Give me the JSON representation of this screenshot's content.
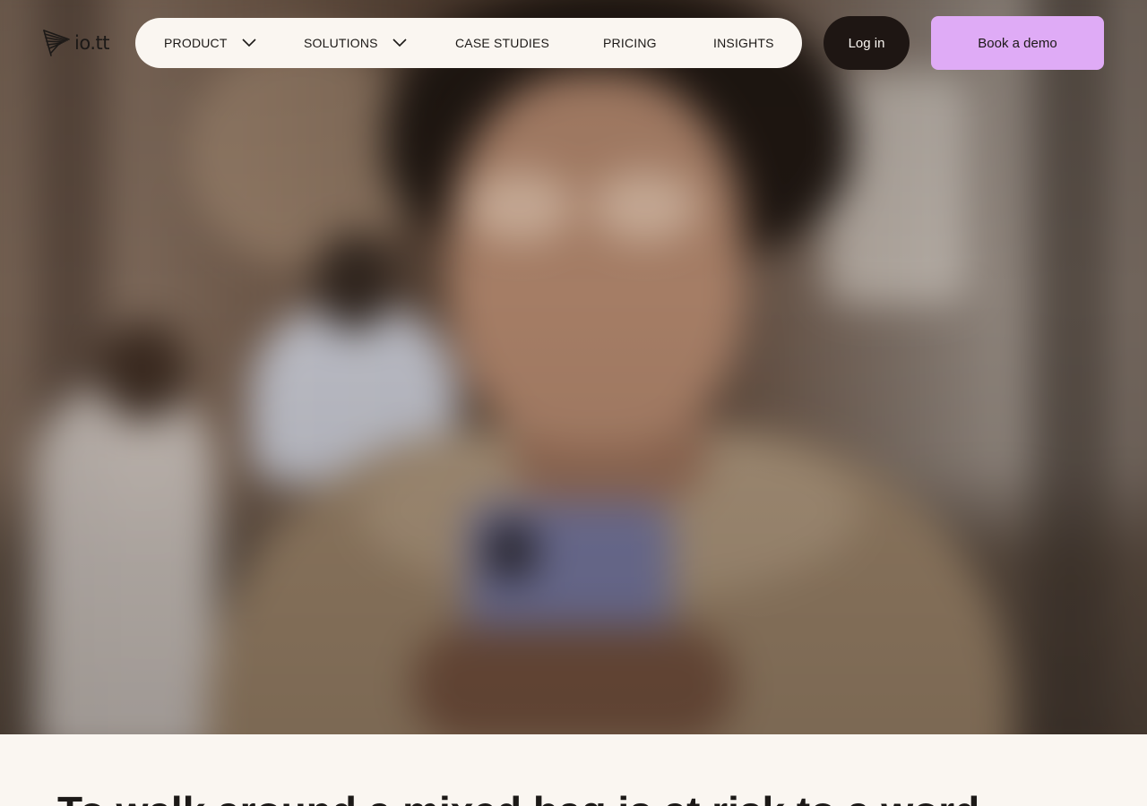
{
  "brand": {
    "logo_text": "io.tt",
    "logo_icon": "wing-mark-icon"
  },
  "nav": {
    "items": [
      {
        "label": "PRODUCT",
        "has_dropdown": true
      },
      {
        "label": "SOLUTIONS",
        "has_dropdown": true
      },
      {
        "label": "CASE STUDIES",
        "has_dropdown": false
      },
      {
        "label": "PRICING",
        "has_dropdown": false
      },
      {
        "label": "INSIGHTS",
        "has_dropdown": false
      }
    ]
  },
  "actions": {
    "login_label": "Log in",
    "demo_label": "Book a demo"
  },
  "below": {
    "heading": "To walk around a mixed bag is at risk to a word..."
  },
  "colors": {
    "page_bg": "#faf6f1",
    "login_bg": "#1e1613",
    "demo_bg": "#dfabf6",
    "text": "#1c1917"
  }
}
